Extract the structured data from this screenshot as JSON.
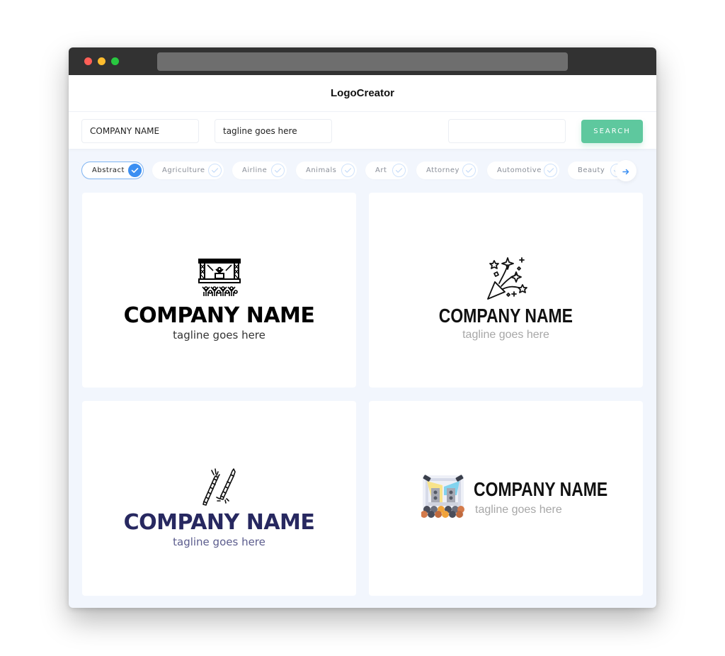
{
  "app": {
    "title": "LogoCreator"
  },
  "toolbar": {
    "company_value": "COMPANY NAME",
    "tagline_value": "tagline goes here",
    "search_value": "",
    "search_label": "SEARCH"
  },
  "categories": [
    {
      "label": "Abstract",
      "selected": true
    },
    {
      "label": "Agriculture",
      "selected": false
    },
    {
      "label": "Airline",
      "selected": false
    },
    {
      "label": "Animals",
      "selected": false
    },
    {
      "label": "Art",
      "selected": false
    },
    {
      "label": "Attorney",
      "selected": false
    },
    {
      "label": "Automotive",
      "selected": false
    },
    {
      "label": "Beauty",
      "selected": false
    }
  ],
  "colors": {
    "accent": "#3b8ff2",
    "search_button": "#5ec89e",
    "navy": "#272860"
  },
  "logos": [
    {
      "icon": "concert-stage-crowd-icon",
      "company": "COMPANY NAME",
      "tagline": "tagline goes here"
    },
    {
      "icon": "party-popper-icon",
      "company": "COMPANY NAME",
      "tagline": "tagline goes here"
    },
    {
      "icon": "firecrackers-icon",
      "company": "COMPANY NAME",
      "tagline": "tagline goes here"
    },
    {
      "icon": "colored-stage-icon",
      "company": "COMPANY NAME",
      "tagline": "tagline goes here"
    }
  ]
}
